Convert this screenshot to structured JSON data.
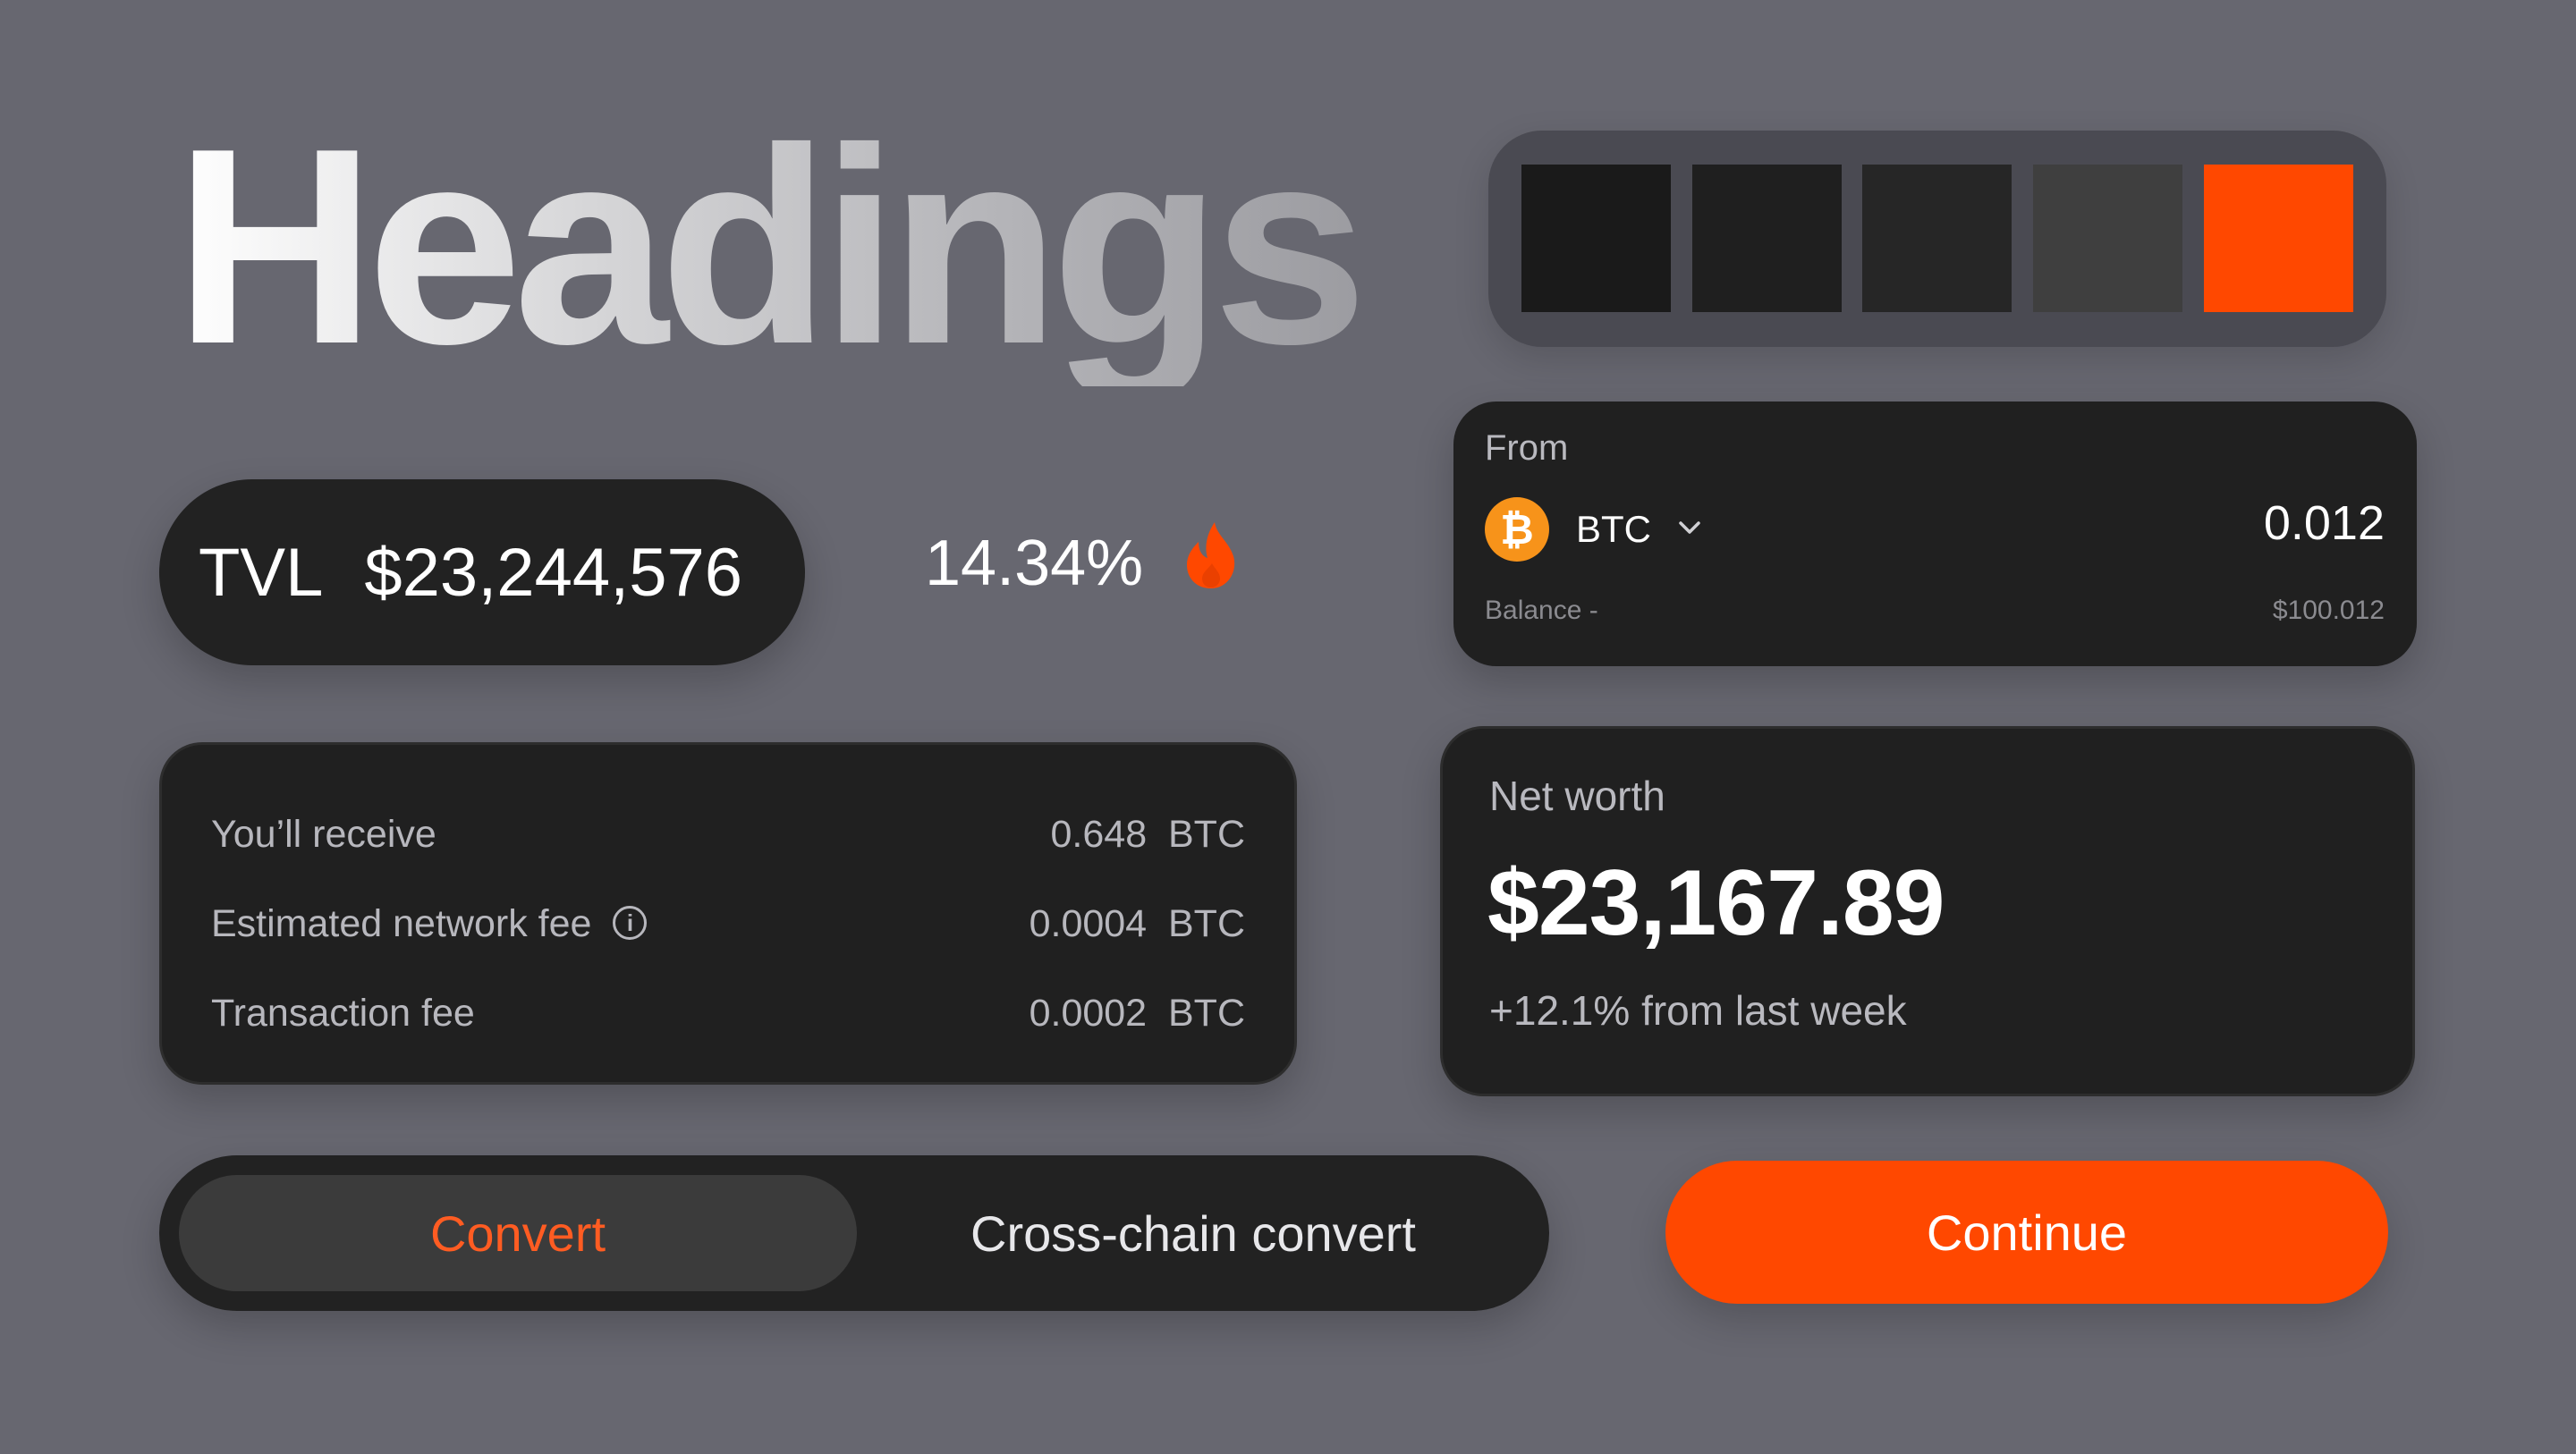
{
  "heading": "Headings",
  "palette": {
    "colors": [
      "#1a1a1a",
      "#1f1f1f",
      "#262626",
      "#3f3f3f",
      "#ff4800"
    ]
  },
  "tvl": {
    "label": "TVL",
    "value": "$23,244,576"
  },
  "apy": {
    "value": "14.34%",
    "icon": "flame-icon",
    "icon_color": "#ff4800"
  },
  "fees": {
    "rows": [
      {
        "label": "You’ll receive",
        "value": "0.648  BTC"
      },
      {
        "label": "Estimated network fee",
        "value": "0.0004  BTC",
        "info_icon": "info-icon"
      },
      {
        "label": "Transaction fee",
        "value": "0.0002  BTC"
      }
    ]
  },
  "toggle": {
    "active_label": "Convert",
    "other_label": "Cross-chain convert",
    "active_color": "#ff5c22"
  },
  "continue_label": "Continue",
  "from_card": {
    "label": "From",
    "token": {
      "symbol": "BTC",
      "icon": "bitcoin-icon",
      "icon_glyph": "₿",
      "icon_color": "#f7931a"
    },
    "amount": "0.012",
    "balance_label": "Balance  -",
    "balance_value": "$100.012"
  },
  "net_worth": {
    "label": "Net worth",
    "value": "$23,167.89",
    "change": "+12.1% from last week"
  },
  "accent": "#ff4800",
  "background": "#676770"
}
